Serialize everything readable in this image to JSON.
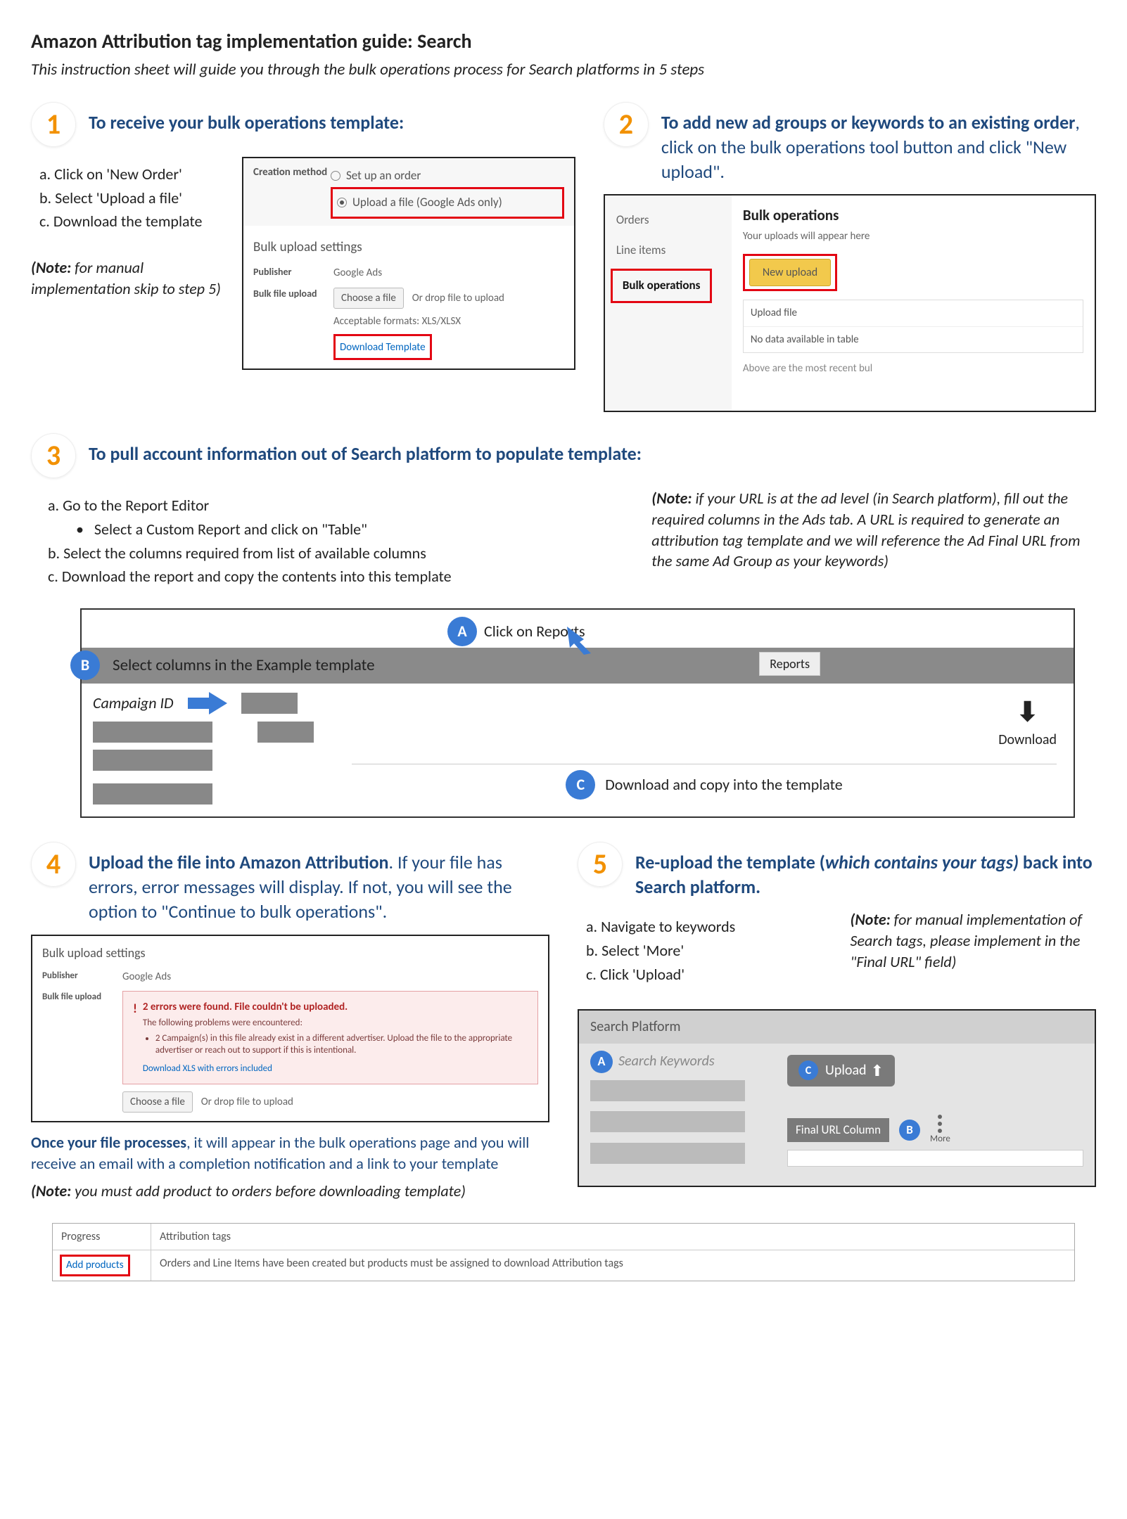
{
  "header": {
    "title": "Amazon Attribution tag implementation guide: Search",
    "subtitle": "This instruction sheet will guide you through the bulk operations process for Search platforms in 5 steps"
  },
  "step1": {
    "num": "1",
    "title": "To receive your bulk operations template:",
    "bullets": {
      "a": "a. Click on 'New Order'",
      "b": "b. Select 'Upload a file'",
      "c": "c. Download the template"
    },
    "note_prefix": "(Note:",
    "note_rest": " for manual implementation skip to step 5)",
    "panel": {
      "creation_method": "Creation method",
      "opt_setup": "Set up an order",
      "opt_upload": "Upload a file (Google Ads only)",
      "bulk_settings": "Bulk upload settings",
      "publisher_lbl": "Publisher",
      "publisher_val": "Google Ads",
      "file_lbl": "Bulk file upload",
      "choose": "Choose a file",
      "drop": "Or drop file to upload",
      "formats": "Acceptable formats: XLS/XLSX",
      "download_tmpl": "Download Template"
    }
  },
  "step2": {
    "num": "2",
    "title_bold": "To add new ad groups or keywords to an existing order",
    "title_rest": ", click on the bulk operations tool button and click \"New upload\".",
    "nav": {
      "orders": "Orders",
      "line_items": "Line items",
      "bulk_ops": "Bulk operations"
    },
    "right": {
      "heading": "Bulk operations",
      "sub": "Your uploads will appear here",
      "new_upload": "New upload",
      "upload_file": "Upload file",
      "nodata": "No data available in table",
      "footer": "Above are the most recent bul"
    }
  },
  "step3": {
    "num": "3",
    "title": "To pull account information out of Search platform to populate template:",
    "bullets": {
      "a": "a. Go to the Report Editor",
      "a2": "Select a Custom Report and click on \"Table\"",
      "b": "b. Select the columns required from list of available columns",
      "c": "c. Download the report and copy the contents into this template"
    },
    "note_prefix": "(Note:",
    "note_rest": " if your URL is at the ad level (in Search platform), fill out the required columns in the Ads tab. A URL is required to generate an attribution tag template and we will reference the Ad Final URL from the same Ad Group as your keywords)",
    "diagram": {
      "A": "A",
      "A_text": "Click on Reports",
      "B": "B",
      "B_text": "Select columns in the Example template",
      "campaign_id": "Campaign ID",
      "reports_btn": "Reports",
      "C": "C",
      "C_text": "Download and copy into the template",
      "download": "Download"
    }
  },
  "step4": {
    "num": "4",
    "title_bold": "Upload the file into Amazon Attribution",
    "title_rest": ". If your file has errors, error messages will display. If not, you will see the option to \"Continue to bulk operations\".",
    "panel": {
      "heading": "Bulk upload settings",
      "publisher_lbl": "Publisher",
      "publisher_val": "Google Ads",
      "file_lbl": "Bulk file upload",
      "err_title": "2 errors were found. File couldn't be uploaded.",
      "err_sub": "The following problems were encountered:",
      "err_item": "2 Campaign(s) in this file already exist in a different advertiser. Upload the file to the appropriate advertiser or reach out to support if this is intentional.",
      "err_link": "Download XLS with errors included",
      "choose": "Choose a file",
      "drop": "Or drop file to upload"
    },
    "after_bold": "Once your file processes",
    "after_rest": ", it will appear in the bulk operations page and you will receive an email with a completion notification and a link to your template",
    "note_prefix": "(Note:",
    "note_rest": " you must add product to orders before downloading template)"
  },
  "step5": {
    "num": "5",
    "title_bold1": "Re-upload the template (",
    "title_boldital": "which contains your tags)",
    "title_bold2": " back into Search platform.",
    "bullets": {
      "a": "a. Navigate to keywords",
      "b": "b. Select 'More'",
      "c": "c. Click 'Upload'"
    },
    "note_prefix": "(Note:",
    "note_rest": " for manual implementation of Search tags, please implement in the \"Final URL\" field)",
    "panel": {
      "heading": "Search Platform",
      "A": "A",
      "A_text": "Search Keywords",
      "C": "C",
      "C_text": "Upload",
      "final_url": "Final URL Column",
      "B": "B",
      "more": "More"
    }
  },
  "bottom": {
    "progress": "Progress",
    "attr_tags": "Attribution tags",
    "add_products": "Add products",
    "msg": "Orders and Line Items have been created but products must be assigned to download Attribution tags"
  }
}
